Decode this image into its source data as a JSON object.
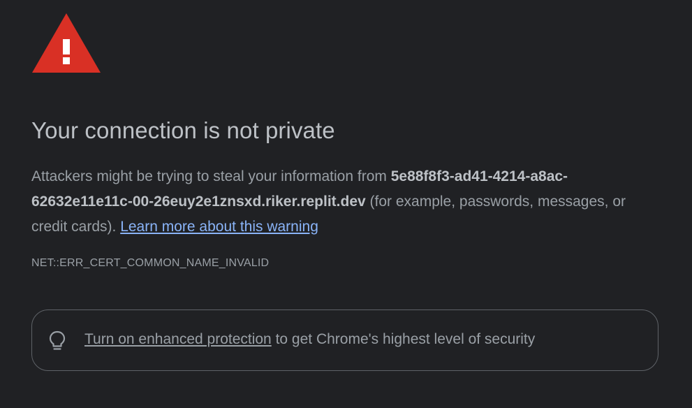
{
  "icons": {
    "warning": "warning-triangle-icon",
    "lightbulb": "lightbulb-icon"
  },
  "colors": {
    "background": "#202124",
    "warning_red": "#d93025",
    "link_blue": "#8ab4f8"
  },
  "heading": "Your connection is not private",
  "message": {
    "prefix": "Attackers might be trying to steal your information from ",
    "host_line1": "5e88f8f3-ad41-4214-a8ac-",
    "host_line2": "62632e11e11c-00-26euy2e1znsxd.riker.replit.dev",
    "suffix": " (for example, passwords, messages, or credit cards). ",
    "learn_more": "Learn more about this warning"
  },
  "error_code": "NET::ERR_CERT_COMMON_NAME_INVALID",
  "enhanced_protection": {
    "link": "Turn on enhanced protection",
    "text": " to get Chrome's highest level of security"
  }
}
